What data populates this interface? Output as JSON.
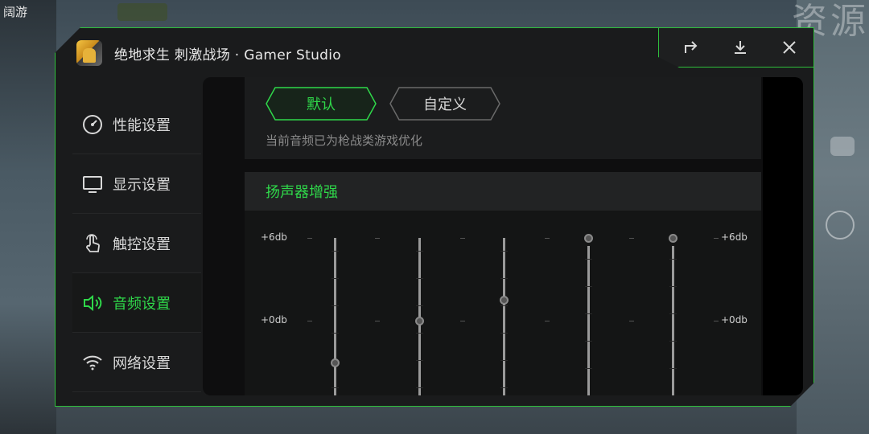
{
  "background": {
    "top_left_text": "阔游",
    "top_right_text": "资源"
  },
  "window": {
    "title": "绝地求生 刺激战场 · Gamer Studio",
    "accent_color": "#2fd84a",
    "controls": [
      {
        "name": "share-icon"
      },
      {
        "name": "download-icon"
      },
      {
        "name": "close-icon"
      }
    ]
  },
  "sidebar": {
    "items": [
      {
        "label": "性能设置",
        "icon": "speedometer-icon",
        "active": false
      },
      {
        "label": "显示设置",
        "icon": "monitor-icon",
        "active": false
      },
      {
        "label": "触控设置",
        "icon": "touch-icon",
        "active": false
      },
      {
        "label": "音频设置",
        "icon": "speaker-icon",
        "active": true
      },
      {
        "label": "网络设置",
        "icon": "wifi-icon",
        "active": false
      }
    ]
  },
  "audio": {
    "mode_default": "默认",
    "mode_custom": "自定义",
    "selected_mode": "默认",
    "hint": "当前音频已为枪战类游戏优化",
    "speaker_section": "扬声器增强",
    "db_top_left": "+6db",
    "db_top_right": "+6db",
    "db_mid_left": "+0db",
    "db_mid_right": "+0db",
    "bands_db": [
      -3,
      0,
      1.5,
      6,
      6
    ]
  }
}
